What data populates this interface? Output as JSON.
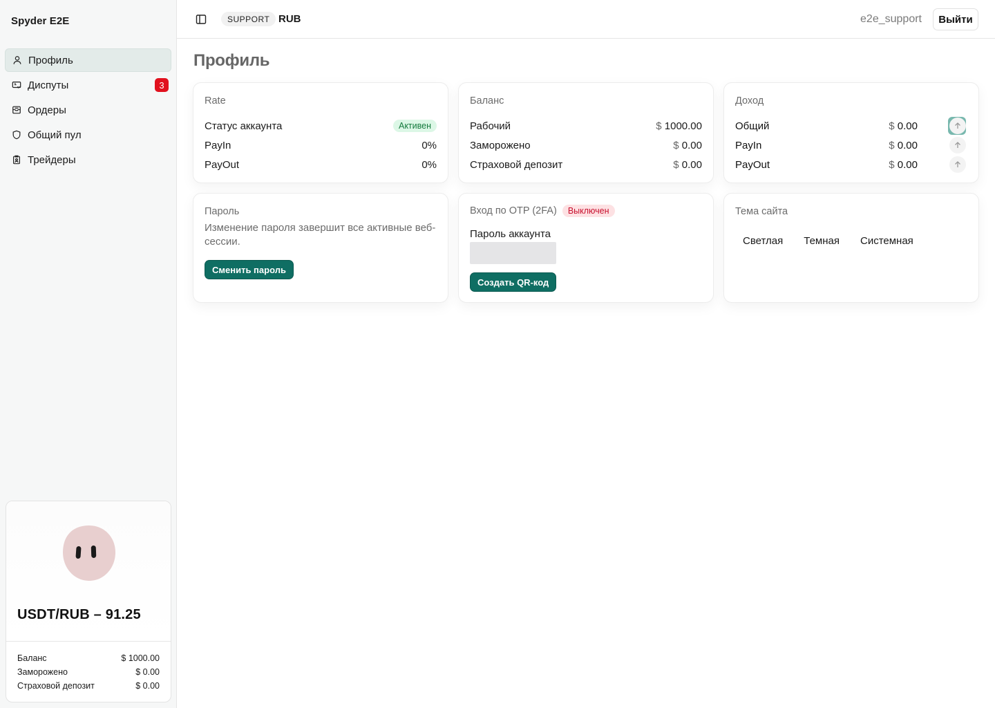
{
  "app": {
    "brand": "Spyder E2E"
  },
  "sidebar": {
    "items": [
      {
        "label": "Профиль",
        "icon": "user-icon",
        "active": true
      },
      {
        "label": "Диспуты",
        "icon": "ticket-icon",
        "badge": "3"
      },
      {
        "label": "Ордеры",
        "icon": "inbox-icon"
      },
      {
        "label": "Общий пул",
        "icon": "shield-icon"
      },
      {
        "label": "Трейдеры",
        "icon": "badge-icon"
      }
    ],
    "rate_card": {
      "title": "USDT/RUB – 91.25",
      "rows": [
        {
          "label": "Баланс",
          "value": "$ 1000.00"
        },
        {
          "label": "Заморожено",
          "value": "$ 0.00"
        },
        {
          "label": "Страховой депозит",
          "value": "$ 0.00"
        }
      ]
    }
  },
  "header": {
    "role": "SUPPORT",
    "currency": "RUB",
    "username": "e2e_support",
    "logout_label": "Выйти"
  },
  "main": {
    "title": "Профиль",
    "rate": {
      "title": "Rate",
      "status_label": "Статус аккаунта",
      "status_value": "Активен",
      "payin_label": "PayIn",
      "payin_value": "0%",
      "payout_label": "PayOut",
      "payout_value": "0%"
    },
    "balance": {
      "title": "Баланс",
      "rows": [
        {
          "label": "Рабочий",
          "currency": "$",
          "amount": "1000.00"
        },
        {
          "label": "Заморожено",
          "currency": "$",
          "amount": "0.00"
        },
        {
          "label": "Страховой депозит",
          "currency": "$",
          "amount": "0.00"
        }
      ]
    },
    "income": {
      "title": "Доход",
      "rows": [
        {
          "label": "Общий",
          "currency": "$",
          "amount": "0.00"
        },
        {
          "label": "PayIn",
          "currency": "$",
          "amount": "0.00"
        },
        {
          "label": "PayOut",
          "currency": "$",
          "amount": "0.00"
        }
      ]
    },
    "password": {
      "title": "Пароль",
      "description": "Изменение пароля завершит все активные веб-сессии.",
      "button_label": "Сменить пароль"
    },
    "otp": {
      "title": "Вход по OTP (2FA)",
      "status": "Выключен",
      "field_label": "Пароль аккаунта",
      "button_label": "Создать QR-код"
    },
    "theme": {
      "title": "Тема сайта",
      "options": [
        "Светлая",
        "Темная",
        "Системная"
      ]
    }
  },
  "colors": {
    "accent": "#0f6e63",
    "active_nav": "#e3ebe9",
    "badge_red": "#e1111e",
    "status_green_bg": "#dcf7e6",
    "status_red_bg": "#fde1e3"
  }
}
